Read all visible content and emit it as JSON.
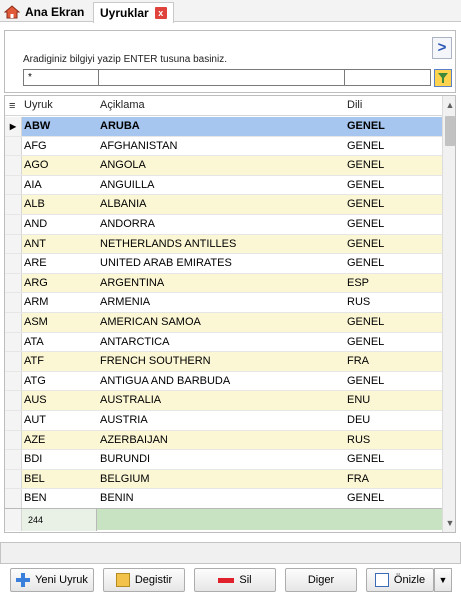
{
  "tabs": {
    "home_label": "Ana Ekran",
    "active_label": "Uyruklar",
    "close_glyph": "x"
  },
  "search": {
    "hint": "Aradiginiz bilgiyi yazip ENTER tusuna basiniz.",
    "box1_value": "*",
    "box2_value": "",
    "box3_value": "",
    "nav_glyph": ">"
  },
  "grid": {
    "columns": {
      "col1": "Uyruk",
      "col2": "Açiklama",
      "col3": "Dili"
    },
    "rows": [
      {
        "code": "ABW",
        "desc": "ARUBA",
        "lang": "GENEL"
      },
      {
        "code": "AFG",
        "desc": "AFGHANISTAN",
        "lang": "GENEL"
      },
      {
        "code": "AGO",
        "desc": "ANGOLA",
        "lang": "GENEL"
      },
      {
        "code": "AIA",
        "desc": "ANGUILLA",
        "lang": "GENEL"
      },
      {
        "code": "ALB",
        "desc": "ALBANIA",
        "lang": "GENEL"
      },
      {
        "code": "AND",
        "desc": "ANDORRA",
        "lang": "GENEL"
      },
      {
        "code": "ANT",
        "desc": "NETHERLANDS ANTILLES",
        "lang": "GENEL"
      },
      {
        "code": "ARE",
        "desc": "UNITED ARAB EMIRATES",
        "lang": "GENEL"
      },
      {
        "code": "ARG",
        "desc": "ARGENTINA",
        "lang": "ESP"
      },
      {
        "code": "ARM",
        "desc": "ARMENIA",
        "lang": "RUS"
      },
      {
        "code": "ASM",
        "desc": "AMERICAN SAMOA",
        "lang": "GENEL"
      },
      {
        "code": "ATA",
        "desc": "ANTARCTICA",
        "lang": "GENEL"
      },
      {
        "code": "ATF",
        "desc": "FRENCH SOUTHERN",
        "lang": "FRA"
      },
      {
        "code": "ATG",
        "desc": "ANTIGUA AND BARBUDA",
        "lang": "GENEL"
      },
      {
        "code": "AUS",
        "desc": "AUSTRALIA",
        "lang": "ENU"
      },
      {
        "code": "AUT",
        "desc": "AUSTRIA",
        "lang": "DEU"
      },
      {
        "code": "AZE",
        "desc": "AZERBAIJAN",
        "lang": "RUS"
      },
      {
        "code": "BDI",
        "desc": "BURUNDI",
        "lang": "GENEL"
      },
      {
        "code": "BEL",
        "desc": "BELGIUM",
        "lang": "FRA"
      },
      {
        "code": "BEN",
        "desc": "BENIN",
        "lang": "GENEL"
      }
    ],
    "record_count": "244"
  },
  "buttons": {
    "new": "Yeni Uyruk",
    "edit": "Degistir",
    "delete": "Sil",
    "other": "Diger",
    "preview": "Önizle"
  },
  "icons": {
    "home": "home-icon",
    "close": "close-icon",
    "nav": "chevron-right-icon",
    "filter": "filter-icon",
    "new": "plus-icon",
    "edit": "pencil-icon",
    "delete": "minus-icon",
    "preview": "preview-icon",
    "dropdown": "chevron-down-icon"
  },
  "colors": {
    "selected_row": "#a6c6ef",
    "odd_row": "#fbf6d4",
    "footer": "#c7e3c2",
    "close_tab": "#e0433b"
  }
}
